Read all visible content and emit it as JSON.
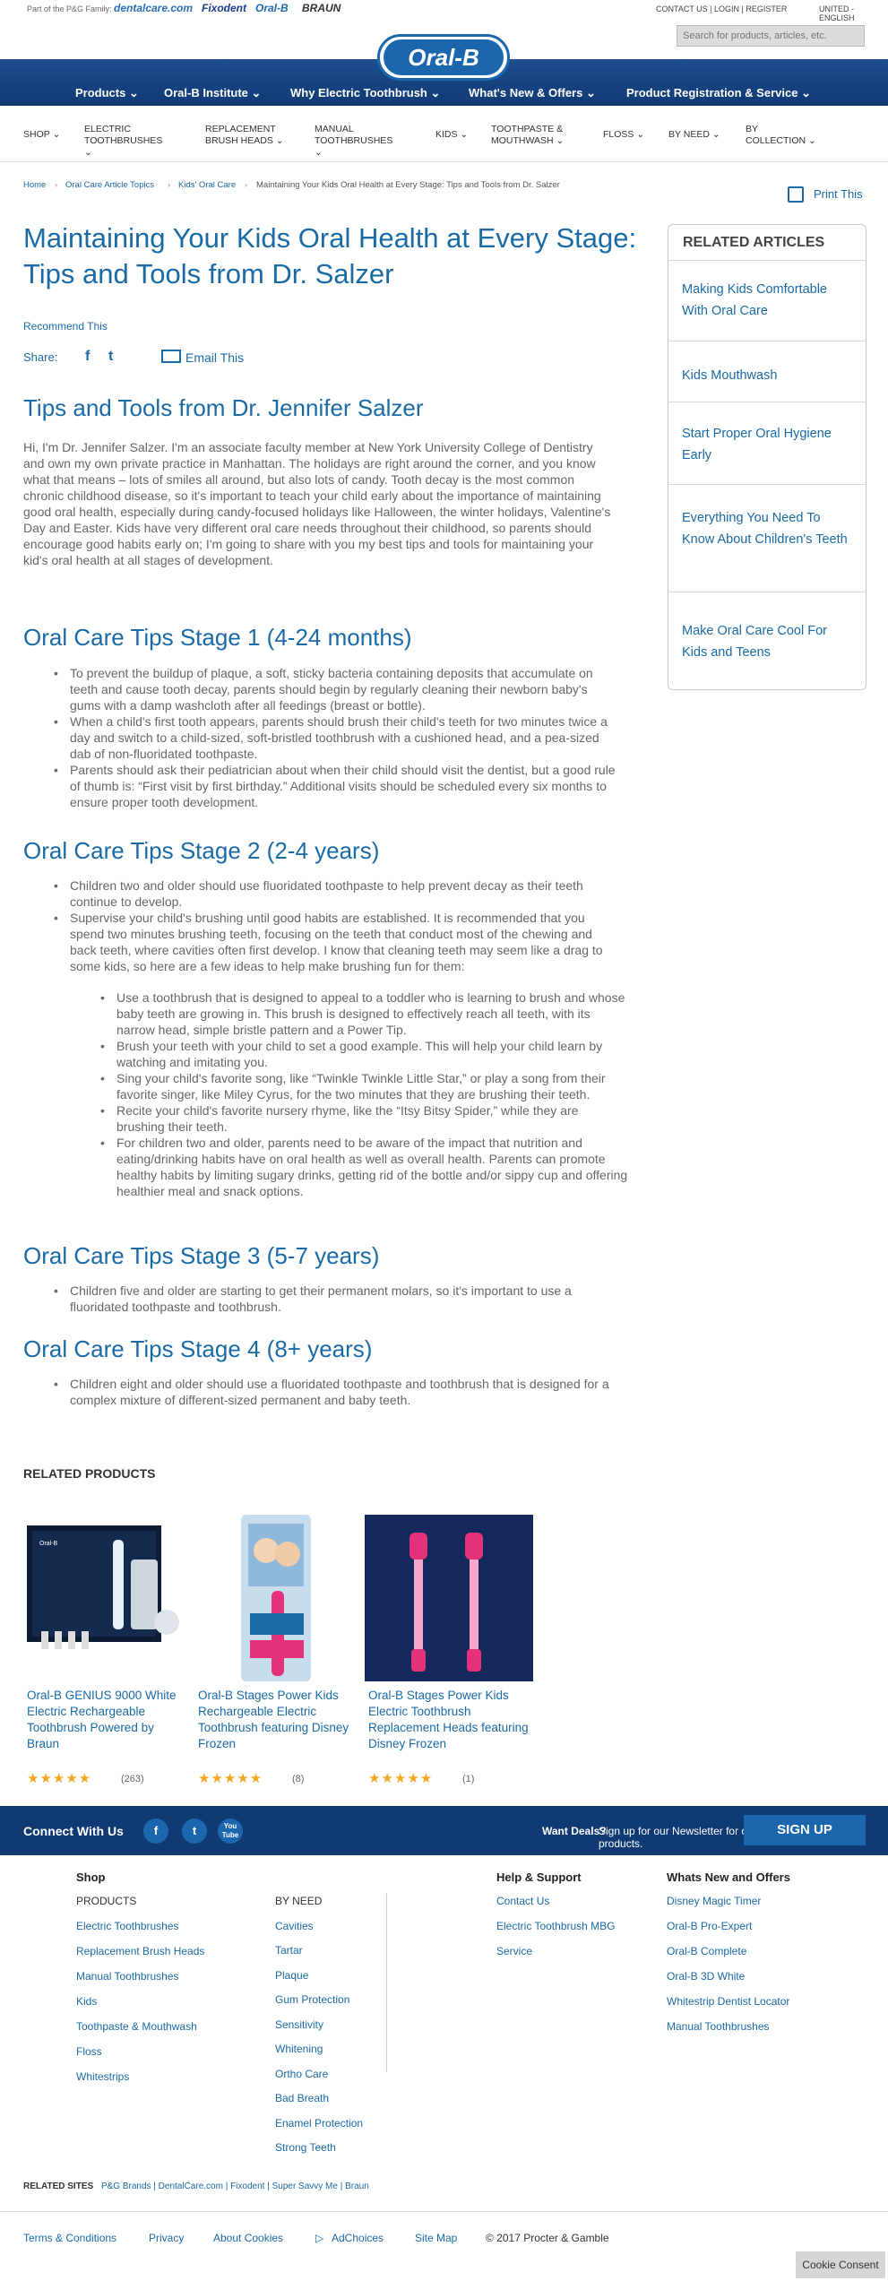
{
  "topbar": {
    "family_label": "Part of the P&G Family:",
    "family_brands": [
      "dentalcare.com",
      "Fixodent",
      "Oral-B",
      "BRAUN"
    ],
    "account_links": "CONTACT US | LOGIN | REGISTER",
    "language": "UNITED - ENGLISH",
    "search_placeholder": "Search for products, articles, etc."
  },
  "brand": {
    "logo_text": "Oral-B",
    "primary_color": "#1b66ad",
    "nav_color": "#0f3a74"
  },
  "main_nav": [
    "Products",
    "Oral-B Institute",
    "Why Electric Toothbrush",
    "What's New & Offers",
    "Product Registration & Service"
  ],
  "sub_nav": [
    "SHOP",
    "ELECTRIC TOOTHBRUSHES",
    "REPLACEMENT BRUSH HEADS",
    "MANUAL TOOTHBRUSHES",
    "KIDS",
    "TOOTHPASTE & MOUTHWASH",
    "FLOSS",
    "BY NEED",
    "BY COLLECTION"
  ],
  "breadcrumb": [
    "Home",
    "Oral Care Article Topics",
    "Kids' Oral Care",
    "Maintaining Your Kids Oral Health at Every Stage: Tips and Tools from Dr. Salzer"
  ],
  "print_label": "Print This",
  "article": {
    "title": "Maintaining Your Kids Oral Health at Every Stage: Tips and Tools from Dr. Salzer",
    "recommend": "Recommend This",
    "share_label": "Share:",
    "email_label": "Email This",
    "intro_heading": "Tips and Tools from Dr. Jennifer Salzer",
    "intro": "Hi, I'm Dr. Jennifer Salzer. I'm an associate faculty member at New York University College of Dentistry and own my own private practice in Manhattan. The holidays are right around the corner, and you know what that means – lots of smiles all around, but also lots of candy. Tooth decay is the most common chronic childhood disease, so it's important to teach your child early about the importance of maintaining good oral health, especially during candy-focused holidays like Halloween, the winter holidays, Valentine's Day and Easter. Kids have very different oral care needs throughout their childhood, so parents should encourage good habits early on; I'm going to share with you my best tips and tools for maintaining your kid's oral health at all stages of development.",
    "stage1_heading": "Oral Care Tips Stage 1 (4-24 months)",
    "stage1": [
      "To prevent the buildup of plaque, a soft, sticky bacteria containing deposits that accumulate on teeth and cause tooth decay, parents should begin by regularly cleaning their newborn baby's gums with a damp washcloth after all feedings (breast or bottle).",
      "When a child's first tooth appears, parents should brush their child's teeth for two minutes twice a day and switch to a child-sized, soft-bristled toothbrush with a cushioned head, and a pea-sized dab of non-fluoridated toothpaste.",
      "Parents should ask their pediatrician about when their child should visit the dentist, but a good rule of thumb is: “First visit by first birthday.” Additional visits should be scheduled every six months to ensure proper tooth development."
    ],
    "stage2_heading": "Oral Care Tips Stage 2 (2-4 years)",
    "stage2": [
      "Children two and older should use fluoridated toothpaste to help prevent decay as their teeth continue to develop.",
      "Supervise your child's brushing until good habits are established. It is recommended that you spend two minutes brushing teeth, focusing on the teeth that conduct most of the chewing and back teeth, where cavities often first develop. I know that cleaning teeth may seem like a drag to some kids, so here are a few ideas to help make brushing fun for them:"
    ],
    "stage2_sub": [
      "Use a toothbrush that is designed to appeal to a toddler who is learning to brush and whose baby teeth are growing in. This brush is designed to effectively reach all teeth, with its narrow head, simple bristle pattern and a Power Tip.",
      "Brush your teeth with your child to set a good example. This will help your child learn by watching and imitating you.",
      "Sing your child's favorite song, like “Twinkle Twinkle Little Star,” or play a song from their favorite singer, like Miley Cyrus, for the two minutes that they are brushing their teeth.",
      "Recite your child's favorite nursery rhyme, like the “Itsy Bitsy Spider,” while they are brushing their teeth.",
      "For children two and older, parents need to be aware of the impact that nutrition and eating/drinking habits have on oral health as well as overall health. Parents can promote healthy habits by limiting sugary drinks, getting rid of the bottle and/or sippy cup and offering healthier meal and snack options."
    ],
    "stage3_heading": "Oral Care Tips Stage 3 (5-7 years)",
    "stage3": [
      "Children five and older are starting to get their permanent molars, so it's important to use a fluoridated toothpaste and toothbrush."
    ],
    "stage4_heading": "Oral Care Tips Stage 4 (8+ years)",
    "stage4": [
      "Children eight and older should use a fluoridated toothpaste and toothbrush that is designed for a complex mixture of different-sized permanent and baby teeth."
    ]
  },
  "related_articles": {
    "heading": "RELATED ARTICLES",
    "items": [
      "Making Kids Comfortable With Oral Care",
      "Kids Mouthwash",
      "Start Proper Oral Hygiene Early",
      "Everything You Need To Know About Children's Teeth",
      "Make Oral Care Cool For Kids and Teens"
    ]
  },
  "related_products": {
    "heading": "RELATED PRODUCTS",
    "items": [
      {
        "name": "Oral-B GENIUS 9000 White Electric Rechargeable Toothbrush Powered by Braun",
        "rating": 5,
        "stars": "★★★★★",
        "count": "(263)"
      },
      {
        "name": "Oral-B Stages Power Kids Rechargeable Electric Toothbrush featuring Disney Frozen",
        "rating": 5,
        "stars": "★★★★★",
        "count": "(8)"
      },
      {
        "name": "Oral-B Stages Power Kids Electric Toothbrush Replacement Heads featuring Disney Frozen",
        "rating": 5,
        "stars": "★★★★★",
        "count": "(1)"
      }
    ]
  },
  "connect": {
    "label": "Connect With Us",
    "social": [
      "f",
      "t",
      "You Tube"
    ],
    "deals_label": "Want Deals?",
    "deals_text": "Sign up for our Newsletter for offers and the latest on products.",
    "signup": "SIGN UP"
  },
  "footer": {
    "shop_heading": "Shop",
    "shop_col1": [
      "PRODUCTS",
      "Electric Toothbrushes",
      "Replacement Brush Heads",
      "Manual Toothbrushes",
      "Kids",
      "Toothpaste & Mouthwash",
      "Floss",
      "Whitestrips"
    ],
    "shop_col2": [
      "BY NEED",
      "Cavities",
      "Tartar",
      "Plaque",
      "Gum Protection",
      "Sensitivity",
      "Whitening",
      "Ortho Care",
      "Bad Breath",
      "Enamel Protection",
      "Strong Teeth"
    ],
    "help_heading": "Help & Support",
    "help": [
      "Contact Us",
      "Electric Toothbrush MBG",
      "Service"
    ],
    "whats_new_heading": "Whats New and Offers",
    "whats_new": [
      "Disney Magic Timer",
      "Oral-B Pro-Expert",
      "Oral-B Complete",
      "Oral-B 3D White",
      "Whitestrip Dentist Locator",
      "Manual Toothbrushes"
    ],
    "related_sites_label": "RELATED SITES",
    "related_sites": "P&G Brands  |  DentalCare.com  |  Fixodent  |  Super Savvy Me  |  Braun",
    "bottom_links": [
      "Terms & Conditions",
      "Privacy",
      "About Cookies",
      "AdChoices",
      "Site Map"
    ],
    "copyright": "© 2017 Procter & Gamble",
    "cookie_consent": "Cookie Consent"
  }
}
